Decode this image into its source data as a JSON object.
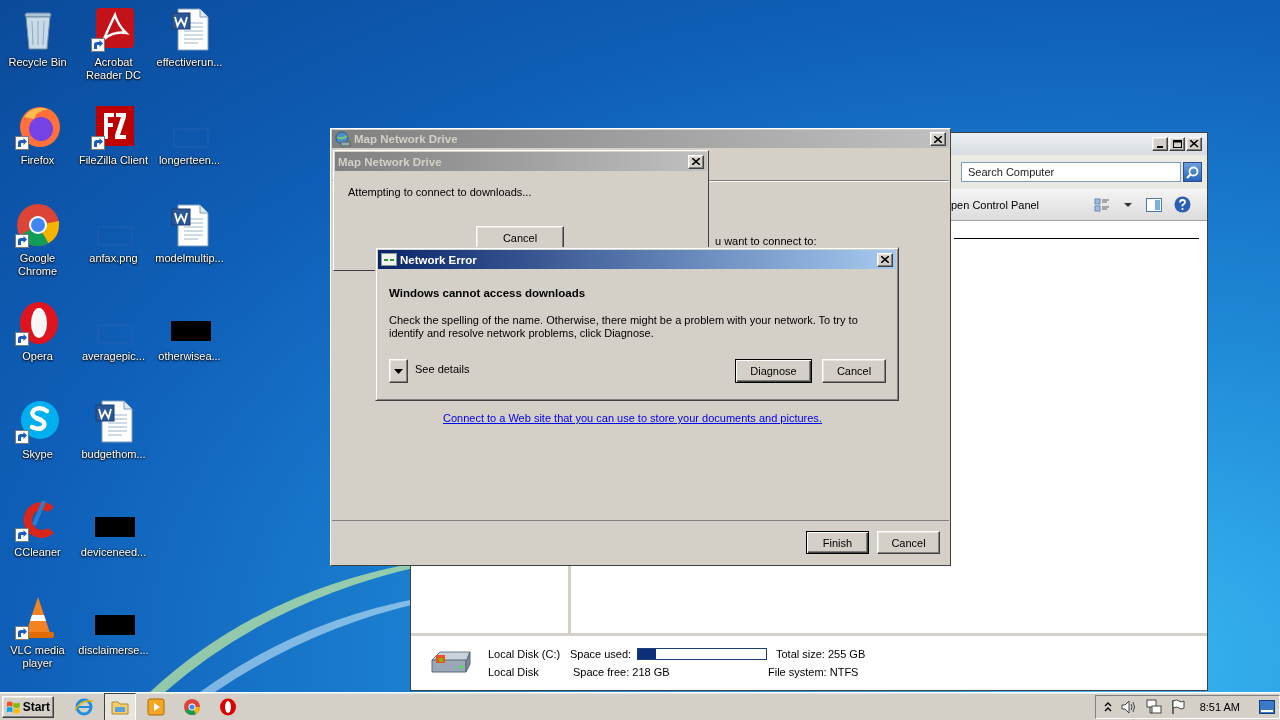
{
  "desktop_icons": [
    {
      "label": "Recycle Bin",
      "kind": "recycle",
      "shortcut": false
    },
    {
      "label": "Firefox",
      "kind": "firefox",
      "shortcut": true
    },
    {
      "label": "Google Chrome",
      "kind": "chrome",
      "shortcut": true
    },
    {
      "label": "Opera",
      "kind": "opera",
      "shortcut": true
    },
    {
      "label": "Skype",
      "kind": "skype",
      "shortcut": true
    },
    {
      "label": "CCleaner",
      "kind": "ccleaner",
      "shortcut": true
    },
    {
      "label": "VLC media player",
      "kind": "vlc",
      "shortcut": true
    },
    {
      "label": "Acrobat Reader DC",
      "kind": "pdf",
      "shortcut": true
    },
    {
      "label": "FileZilla Client",
      "kind": "filezilla",
      "shortcut": true
    },
    {
      "label": "anfax.png",
      "kind": "blank",
      "shortcut": false
    },
    {
      "label": "averagepic...",
      "kind": "blank",
      "shortcut": false
    },
    {
      "label": "budgethom...",
      "kind": "word",
      "shortcut": false
    },
    {
      "label": "deviceneed...",
      "kind": "redacted",
      "shortcut": false
    },
    {
      "label": "disclaimerse...",
      "kind": "redacted",
      "shortcut": false
    },
    {
      "label": "effectiverun...",
      "kind": "word",
      "shortcut": false
    },
    {
      "label": "longerteen...",
      "kind": "blank",
      "shortcut": false
    },
    {
      "label": "modelmultip...",
      "kind": "word",
      "shortcut": false
    },
    {
      "label": "otherwisea...",
      "kind": "redacted",
      "shortcut": false
    }
  ],
  "explorer": {
    "active": false,
    "search": {
      "placeholder": "Search Computer"
    },
    "toolbar_text": "pen Control Panel",
    "details": {
      "name": "Local Disk (C:)",
      "type": "Local Disk",
      "used_label": "Space used:",
      "level": 0.14,
      "free": "Space free: 218 GB",
      "total": "Total size: 255 GB",
      "file_system": "File system: NTFS"
    }
  },
  "wizard": {
    "title": "Map Network Drive",
    "active": false,
    "prompt": "u want to connect to:",
    "link": "Connect to a Web site that you can use to store your documents and pictures.",
    "buttons": [
      {
        "label": "Finish",
        "default": true
      },
      {
        "label": "Cancel",
        "default": false
      }
    ]
  },
  "progress": {
    "title": "Map Network Drive",
    "active": false,
    "message": "Attempting to connect to downloads...",
    "button": "Cancel"
  },
  "error": {
    "title": "Network Error",
    "active": true,
    "heading": "Windows cannot access downloads",
    "message": "Check the spelling of the name. Otherwise, there might be a problem with your network. To try to identify and resolve network problems, click Diagnose.",
    "details_toggle": "See details",
    "buttons": [
      {
        "label": "Diagnose",
        "default": true
      },
      {
        "label": "Cancel",
        "default": false
      }
    ]
  },
  "taskbar": {
    "start": "Start",
    "apps": [
      {
        "kind": "ie",
        "active": false
      },
      {
        "kind": "explorer",
        "active": true
      },
      {
        "kind": "media",
        "active": false
      },
      {
        "kind": "chrome",
        "active": false
      },
      {
        "kind": "opera",
        "active": false
      }
    ],
    "clock": "8:51 AM"
  }
}
